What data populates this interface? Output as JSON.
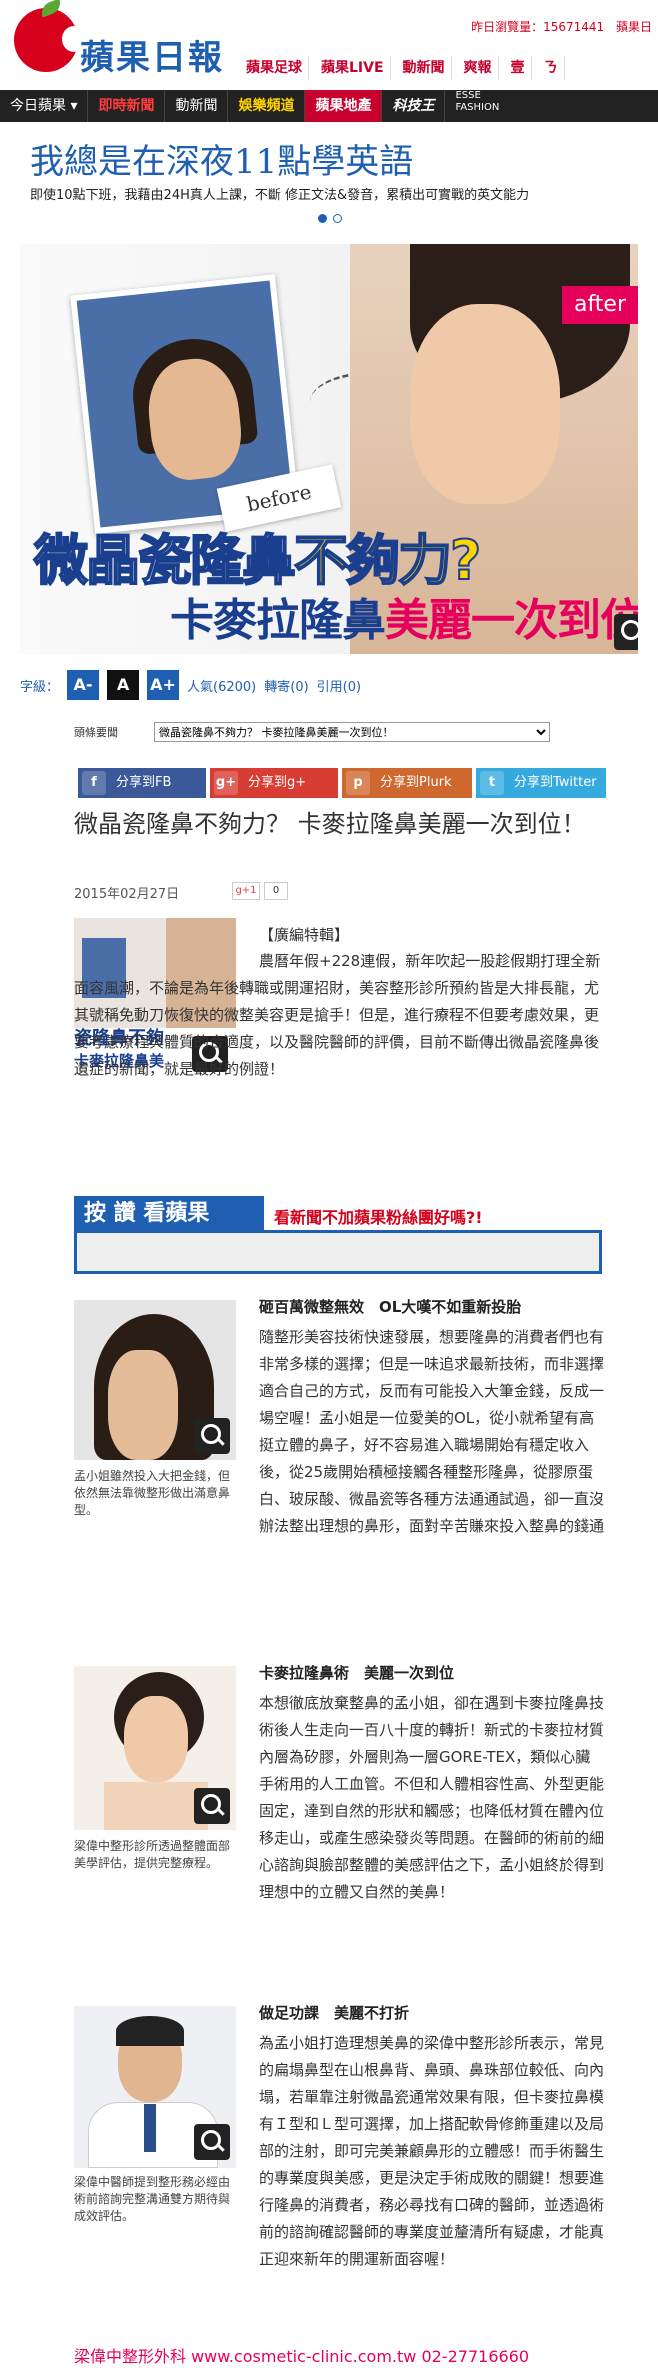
{
  "header": {
    "brand": "蘋果日報",
    "top_links": [
      "昨日瀏覽量：15671441",
      "蘋果日"
    ],
    "channels": [
      "蘋果足球",
      "蘋果LIVE",
      "動新聞",
      "爽報",
      "壹",
      "ㄋ"
    ]
  },
  "nav": {
    "items": [
      "今日蘋果",
      "即時新聞",
      "動新聞",
      "娛樂頻道",
      "蘋果地產",
      "科技王",
      "ESSE FASHION"
    ]
  },
  "promo": {
    "title": "我總是在深夜11點學英語",
    "subtitle": "即使10點下班，我藉由24H真人上課，不斷 修正文法&發音，累積出可實戰的英文能力"
  },
  "hero": {
    "before_label": "before",
    "after_label": "after",
    "line1_a": "微晶瓷隆鼻",
    "line1_b": "不夠力?",
    "line2_a": "卡麥拉隆鼻",
    "line2_b": "美麗一次到位"
  },
  "tools": {
    "font_label": "字級：",
    "font_small": "A-",
    "font_normal": "A",
    "font_large": "A+",
    "popularity": "人氣(6200)",
    "reposts": "轉寄(0)",
    "citations": "引用(0)"
  },
  "related": {
    "label": "頭條要聞",
    "selected": "微晶瓷隆鼻不夠力？ 卡麥拉隆鼻美麗一次到位！"
  },
  "share": {
    "fb": "分享到FB",
    "gplus": "分享到g+",
    "plurk": "分享到Plurk",
    "twitter": "分享到Twitter"
  },
  "article": {
    "headline": "微晶瓷隆鼻不夠力？ 卡麥拉隆鼻美麗一次到位！",
    "date": "2015年02月27日",
    "gplus": "g+1",
    "gplus_count": "0",
    "tag": "【廣編特輯】",
    "p1": "農曆年假+228連假，新年吹起一股趁假期打理全新面容風潮，不論是為年後轉職或開運招財，美容整形診所預約皆是大排長龍，尤其號稱免動刀恢復快的微整美容更是搶手！但是，進行療程不但要考慮效果，更要考慮療程與體質的合適度，以及醫院醫師的評價，目前不斷傳出微晶瓷隆鼻後遺症的新聞，就是最好的例證！",
    "sub1": "砸百萬微整無效　OL大嘆不如重新投胎",
    "p2": "隨整形美容技術快速發展，想要隆鼻的消費者們也有非常多樣的選擇；但是一味追求最新技術，而非選擇適合自己的方式，反而有可能投入大筆金錢，反成一場空喔！孟小姐是一位愛美的OL，從小就希望有高挺立體的鼻子，好不容易進入職場開始有穩定收入後，從25歲開始積極接觸各種整形隆鼻，從膠原蛋白、玻尿酸、微晶瓷等各種方法通通試過，卻一直沒辦法整出理想的鼻形，面對辛苦賺來投入整鼻的錢通通化作泡影，孟小姐一度沮喪到認為這輩子都不可能達成夢想！",
    "cap1": "孟小姐雖然投入大把金錢，但依然無法靠微整形做出滿意鼻型。",
    "sub2": "卡麥拉隆鼻術　美麗一次到位",
    "p3": "本想徹底放棄整鼻的孟小姐，卻在遇到卡麥拉隆鼻技術後人生走向一百八十度的轉折！新式的卡麥拉材質內層為矽膠，外層則為一層GORE-TEX，類似心臟手術用的人工血管。不但和人體相容性高、外型更能固定，達到自然的形狀和觸感；也降低材質在體內位移走山，或產生感染發炎等問題。在醫師的術前的細心諮詢與臉部整體的美感評估之下，孟小姐終於得到理想中的立體又自然的美鼻！",
    "cap2": "梁偉中整形診所透過整體面部美學評估，提供完整療程。",
    "sub3": "做足功課　美麗不打折",
    "p4": "為孟小姐打造理想美鼻的梁偉中整形診所表示，常見的扁塌鼻型在山根鼻背、鼻頭、鼻珠部位較低、向內塌，若單靠注射微晶瓷通常效果有限，但卡麥拉鼻模有Ｉ型和Ｌ型可選擇，加上搭配軟骨修飾重建以及局部的注射，即可完美兼顧鼻形的立體感！而手術醫生的專業度與美感，更是決定手術成敗的關鍵！想要進行隆鼻的消費者，務必尋找有口碑的醫師，並透過術前的諮詢確認醫師的專業度並釐清所有疑慮，才能真正迎來新年的開運新面容喔！",
    "cap3": "梁偉中醫師提到整形務必經由術前諮詢完整溝通雙方期待與成效評估。",
    "footer": "梁偉中整形外科 www.cosmetic-clinic.com.tw 02-27716660"
  },
  "ad": {
    "k_head": "按 讚 看蘋果",
    "k_text": "看新聞不加蘋果粉絲團好嗎?!"
  },
  "colors": {
    "brand_red": "#d6001c",
    "brand_blue": "#1f5fb1",
    "accent_pink": "#e6005c"
  }
}
